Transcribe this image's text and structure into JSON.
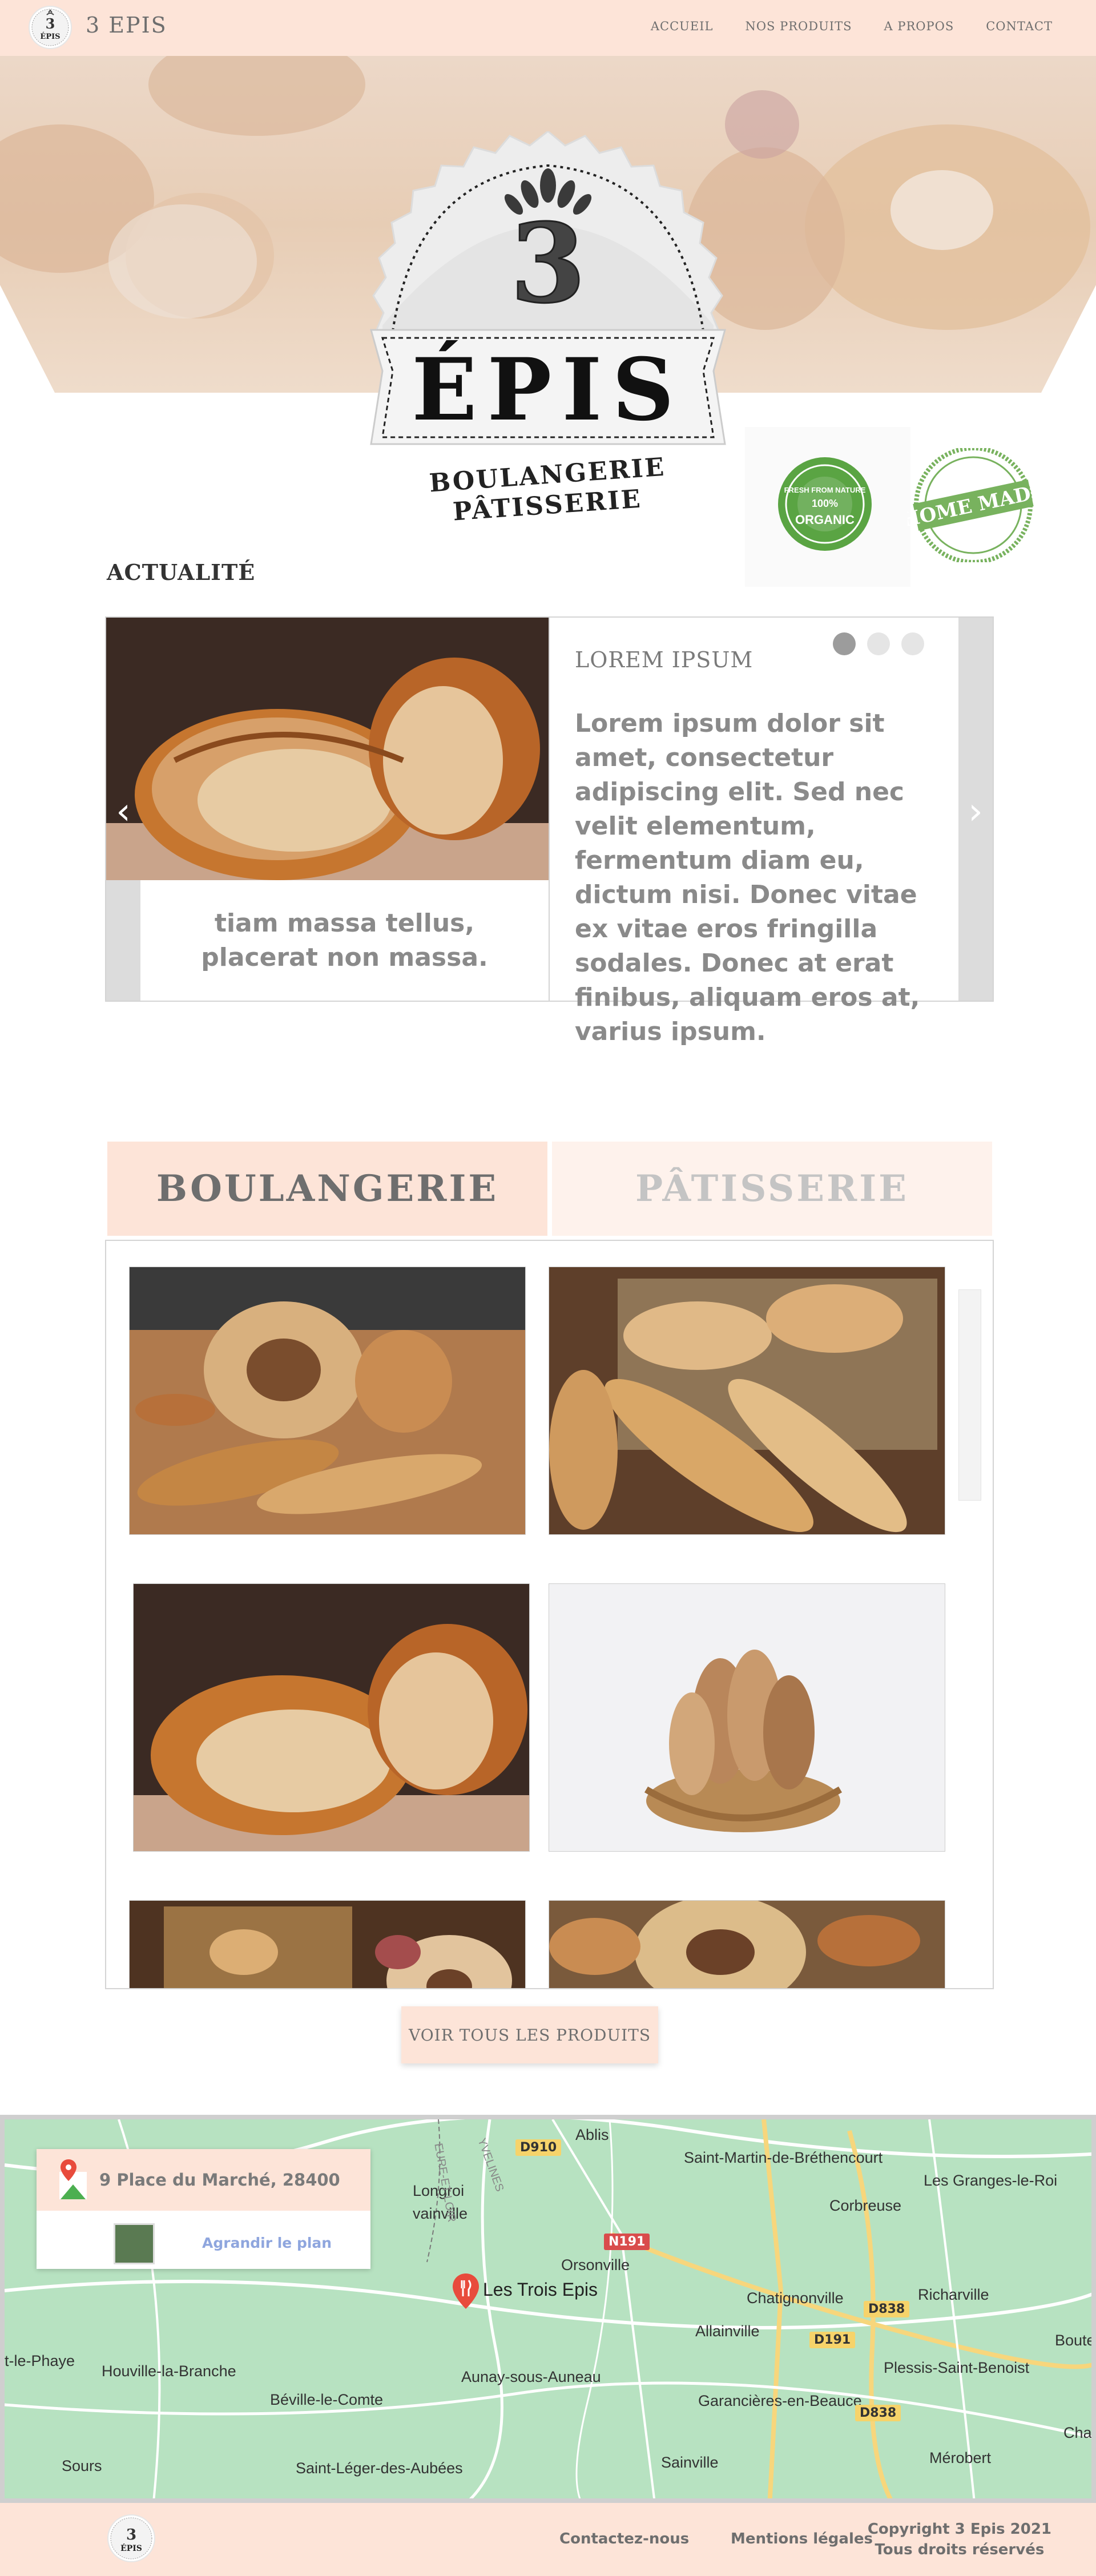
{
  "header": {
    "brand": "3 EPIS",
    "nav": [
      "ACCUEIL",
      "NOS PRODUITS",
      "A PROPOS",
      "CONTACT"
    ]
  },
  "hero": {
    "logo_number": "3",
    "logo_word": "ÉPIS",
    "logo_line1": "BOULANGERIE",
    "logo_line2": "PÂTISSERIE"
  },
  "badges": {
    "organic_top": "FRESH FROM NATURE",
    "organic_pct": "100%",
    "organic_main": "ORGANIC",
    "homemade": "HOME MADE"
  },
  "news": {
    "section_title": "ACTUALITÉ",
    "left_caption": "tiam massa tellus, placerat non massa.",
    "heading": "LOREM IPSUM",
    "body": "Lorem ipsum dolor sit amet, consectetur adipiscing elit. Sed nec velit elementum, fermentum diam eu, dictum nisi. Donec vitae ex vitae eros fringilla sodales. Donec at erat finibus, aliquam eros at, varius ipsum.",
    "prev_arrow": "‹",
    "next_arrow": "›"
  },
  "products": {
    "tabs": [
      "BOULANGERIE",
      "PÂTISSERIE"
    ],
    "view_all": "VOIR TOUS LES PRODUITS"
  },
  "map": {
    "address": "9 Place du Marché, 28400",
    "enlarge": "Agrandir le plan",
    "marker_label": "Les Trois Epis",
    "places": [
      "Ablis",
      "Saint-Martin-de-Bréthencourt",
      "Les Granges-le-Roi",
      "Corbreuse",
      "Orsonville",
      "Richarville",
      "Chatignonville",
      "Allainville",
      "Boutervi",
      "Plessis-Saint-Benoist",
      "Houville-la-Branche",
      "Béville-le-Comte",
      "Aunay-sous-Auneau",
      "Garancières-en-Beauce",
      "Chalo-S",
      "Sours",
      "Saint-Léger-des-Aubées",
      "Sainville",
      "Mérobert",
      "t-le-Phaye",
      "Longroi",
      "vainville",
      "EURE-ET-LOIR",
      "YVELINES"
    ],
    "roads": [
      "D910",
      "N191",
      "D838",
      "D191",
      "D838"
    ]
  },
  "footer": {
    "contact": "Contactez-nous",
    "legal": "Mentions légales",
    "copyright_line1": "Copyright 3 Epis 2021",
    "copyright_line2": "Tous droits réservés"
  },
  "colors": {
    "peach": "#fde4d8",
    "peach_light": "#fef2ec",
    "text_grey": "#6e6e6e",
    "organic_green": "#5aa443"
  }
}
